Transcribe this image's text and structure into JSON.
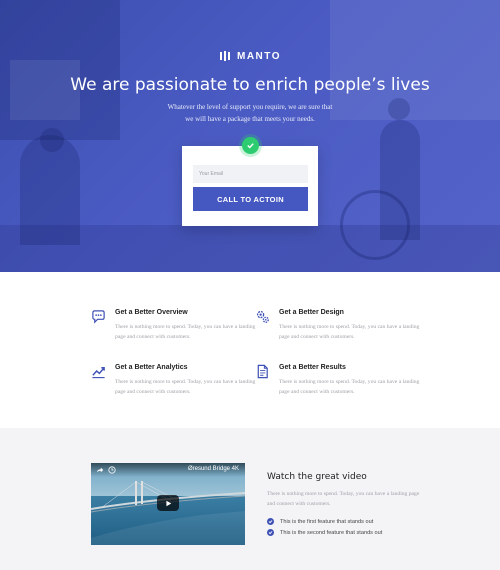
{
  "hero": {
    "brand_name": "MANTO",
    "title": "We are passionate to enrich people’s lives",
    "subtitle_line1": "Whatever the level of support you require, we are sure that",
    "subtitle_line2": "we will have a package that meets your needs.",
    "email_placeholder": "Your Email",
    "cta_label": "CALL TO ACTOIN",
    "background_color": "#4a5bc3"
  },
  "features": [
    {
      "icon": "chat-bubble-icon",
      "title": "Get a Better Overview",
      "text": "There is nothing more to spend. Today, you can have a landing page and connect with customers."
    },
    {
      "icon": "gears-icon",
      "title": "Get a Better Design",
      "text": "There is nothing more to spend. Today, you can have a landing page and connect with customers."
    },
    {
      "icon": "trend-chart-icon",
      "title": "Get a Better Analytics",
      "text": "There is nothing more to spend. Today, you can have a landing page and connect with customers."
    },
    {
      "icon": "document-icon",
      "title": "Get a Better Results",
      "text": "There is nothing more to spend. Today, you can have a landing page and connect with customers."
    }
  ],
  "video": {
    "player_title": "Øresund Bridge 4K",
    "heading": "Watch the great video",
    "text": "There is nothing more to spend. Today, you can have a landing page and connect with customers.",
    "features": [
      "This is the first feature that stands out",
      "This is the second feature that stands out"
    ]
  },
  "colors": {
    "accent": "#4557c0",
    "success": "#2ecc71",
    "icon_blue": "#3f51b5"
  }
}
